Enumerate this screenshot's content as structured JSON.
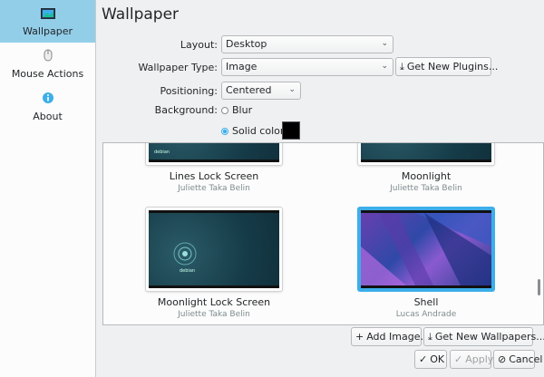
{
  "sidebar": {
    "items": [
      {
        "label": "Wallpaper",
        "icon": "monitor-wallpaper-icon"
      },
      {
        "label": "Mouse Actions",
        "icon": "mouse-icon"
      },
      {
        "label": "About",
        "icon": "info-icon"
      }
    ]
  },
  "page": {
    "title": "Wallpaper"
  },
  "form": {
    "layout_label": "Layout:",
    "layout_value": "Desktop",
    "type_label": "Wallpaper Type:",
    "type_value": "Image",
    "get_plugins": "Get New Plugins...",
    "positioning_label": "Positioning:",
    "positioning_value": "Centered",
    "background_label": "Background:",
    "blur_label": "Blur",
    "solid_label": "Solid color",
    "solid_color": "#000000"
  },
  "wallpapers": [
    {
      "name": "Lines Lock Screen",
      "author": "Juliette Taka Belin"
    },
    {
      "name": "Moonlight",
      "author": "Juliette Taka Belin"
    },
    {
      "name": "Moonlight Lock Screen",
      "author": "Juliette Taka Belin"
    },
    {
      "name": "Shell",
      "author": "Lucas Andrade"
    }
  ],
  "thumb_text": {
    "debian": "debian"
  },
  "actions": {
    "add_image": "Add Image...",
    "get_wallpapers": "Get New Wallpapers...",
    "ok": "OK",
    "apply": "Apply",
    "cancel": "Cancel"
  },
  "colors": {
    "accent": "#3daee9",
    "sidebar_active": "#93cee9"
  }
}
